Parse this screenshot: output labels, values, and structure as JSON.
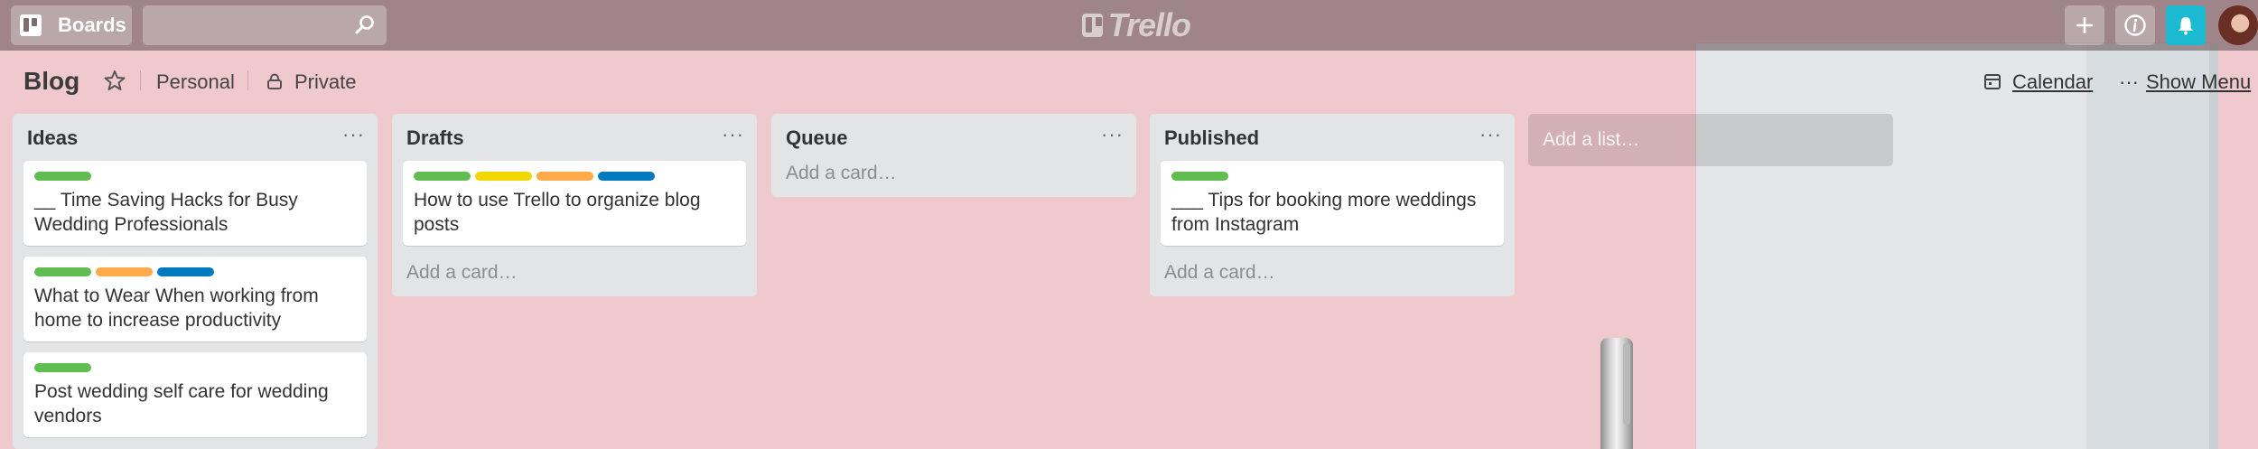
{
  "header": {
    "boards_label": "Boards",
    "search_placeholder": "",
    "logo_text": "Trello"
  },
  "board": {
    "title": "Blog",
    "team": "Personal",
    "privacy": "Private",
    "calendar_label": "Calendar",
    "menu_label": "Show Menu"
  },
  "colors": {
    "green": "#61bd4f",
    "yellow": "#f2d600",
    "orange": "#ffab4a",
    "blue": "#0079bf"
  },
  "lists": [
    {
      "title": "Ideas",
      "menu": "···",
      "cards": [
        {
          "title": "__ Time Saving Hacks for Busy Wedding Professionals",
          "labels": [
            "green"
          ]
        },
        {
          "title": "What to Wear When working from home to increase productivity",
          "labels": [
            "green",
            "orange",
            "blue"
          ]
        },
        {
          "title": "Post wedding self care for wedding vendors",
          "labels": [
            "green"
          ]
        }
      ]
    },
    {
      "title": "Drafts",
      "menu": "···",
      "add_card": "Add a card…",
      "cards": [
        {
          "title": "How to use Trello to organize blog posts",
          "labels": [
            "green",
            "yellow",
            "orange",
            "blue"
          ]
        }
      ]
    },
    {
      "title": "Queue",
      "menu": "···",
      "add_card": "Add a card…",
      "cards": []
    },
    {
      "title": "Published",
      "menu": "···",
      "add_card": "Add a card…",
      "cards": [
        {
          "title": "___ Tips for booking more weddings from Instagram",
          "labels": [
            "green"
          ]
        }
      ]
    }
  ],
  "add_list": "Add a list…"
}
